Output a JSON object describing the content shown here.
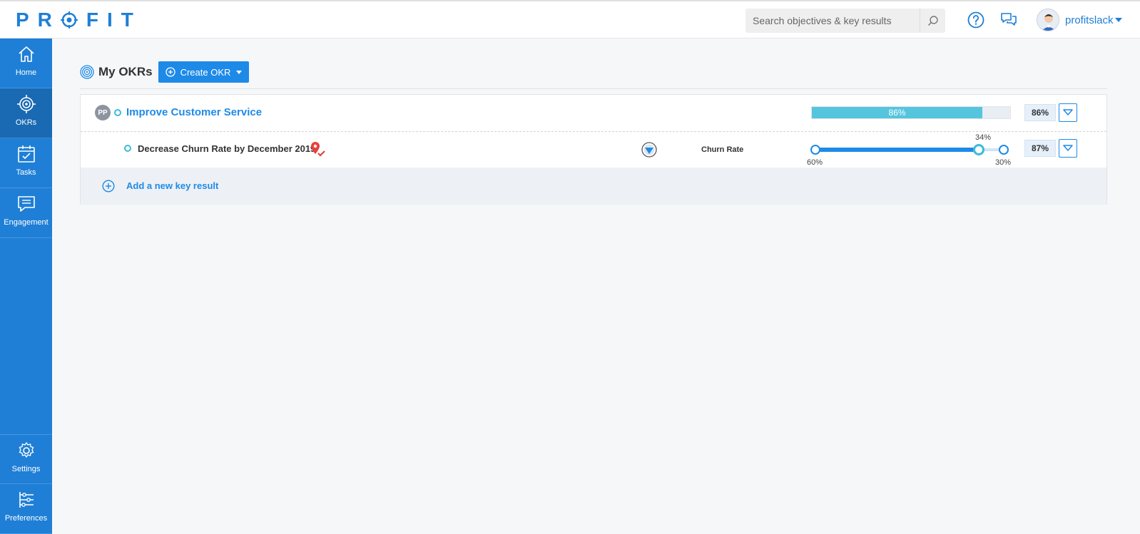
{
  "header": {
    "logo": {
      "left": "PR",
      "right": "FIT"
    },
    "search": {
      "placeholder": "Search objectives & key results"
    },
    "user": {
      "name": "profitslack"
    }
  },
  "sidebar": {
    "items": [
      {
        "label": "Home",
        "icon": "home-icon"
      },
      {
        "label": "OKRs",
        "icon": "target-icon",
        "active": true
      },
      {
        "label": "Tasks",
        "icon": "calendar-check-icon"
      },
      {
        "label": "Engagement",
        "icon": "chat-icon"
      },
      {
        "label": "Settings",
        "icon": "gear-icon"
      },
      {
        "label": "Preferences",
        "icon": "sliders-icon"
      }
    ]
  },
  "main": {
    "title": "My OKRs",
    "create_label": "Create OKR",
    "objective": {
      "initials": "PP",
      "title": "Improve Customer Service",
      "progress": 86,
      "progress_label": "86%",
      "score_label": "86%"
    },
    "key_result": {
      "title": "Decrease Churn Rate by December 2019",
      "metric": "Churn Rate",
      "start_label": "60%",
      "current_label": "34%",
      "target_label": "30%",
      "start": 60,
      "current": 34,
      "target": 30,
      "score_label": "87%"
    },
    "add_key_result_label": "Add a new key result"
  },
  "colors": {
    "brand": "#1f7fd6",
    "accent": "#1e8ae8",
    "progress": "#55c5dd",
    "marker": "#e8413a"
  }
}
